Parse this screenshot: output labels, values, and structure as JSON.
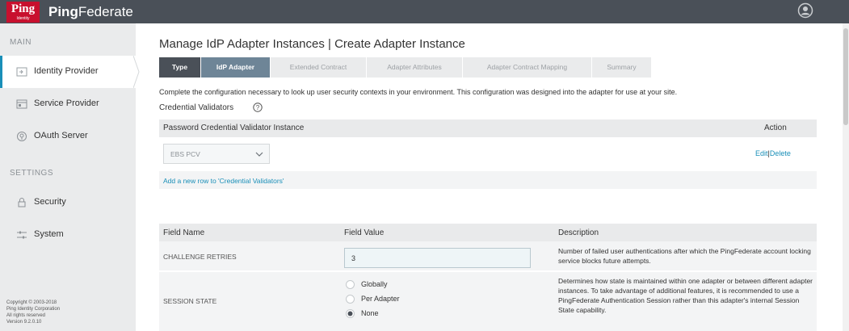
{
  "header": {
    "logo_text": "Ping",
    "logo_subtext": "Identity",
    "brand_prefix": "Ping",
    "brand_suffix": "Federate",
    "user_icon": "user-circle-icon"
  },
  "sidebar": {
    "main_heading": "MAIN",
    "settings_heading": "SETTINGS",
    "items": [
      {
        "label": "Identity Provider",
        "icon": "idp-icon",
        "active": true
      },
      {
        "label": "Service Provider",
        "icon": "sp-icon",
        "active": false
      },
      {
        "label": "OAuth Server",
        "icon": "oauth-icon",
        "active": false
      },
      {
        "label": "Security",
        "icon": "lock-icon",
        "active": false
      },
      {
        "label": "System",
        "icon": "sliders-icon",
        "active": false
      }
    ],
    "copyright": [
      "Copyright © 2003-2018",
      "Ping Identity Corporation",
      "All rights reserved",
      "Version 9.2.0.10"
    ]
  },
  "main": {
    "title": "Manage IdP Adapter Instances | Create Adapter Instance",
    "tabs": [
      {
        "label": "Type",
        "state": "done"
      },
      {
        "label": "IdP Adapter",
        "state": "current"
      },
      {
        "label": "Extended Contract",
        "state": "pending"
      },
      {
        "label": "Adapter Attributes",
        "state": "pending"
      },
      {
        "label": "Adapter Contract Mapping",
        "state": "pending"
      },
      {
        "label": "Summary",
        "state": "pending"
      }
    ],
    "intro": "Complete the configuration necessary to look up user security contexts in your environment. This configuration was designed into the adapter for use at your site.",
    "credential_validators": {
      "label": "Credential Validators",
      "col_instance": "Password Credential Validator Instance",
      "col_action": "Action",
      "selected": "EBS PCV",
      "edit": "Edit",
      "separator": "|",
      "delete": "Delete",
      "add_row": "Add a new row to 'Credential Validators'"
    },
    "fields": {
      "col_name": "Field Name",
      "col_value": "Field Value",
      "col_desc": "Description",
      "rows": [
        {
          "name": "CHALLENGE RETRIES",
          "value": "3",
          "description": "Number of failed user authentications after which the PingFederate account locking service blocks future attempts."
        },
        {
          "name": "SESSION STATE",
          "options": [
            "Globally",
            "Per Adapter",
            "None"
          ],
          "selected": "None",
          "description": "Determines how state is maintained within one adapter or between different adapter instances. To take advantage of additional features, it is recommended to use a PingFederate Authentication Session rather than this adapter's internal Session State capability."
        }
      ]
    }
  },
  "colors": {
    "topbar": "#4a5058",
    "brand_red": "#c8102e",
    "link": "#1a8fb8",
    "tab_current": "#6e8597"
  }
}
